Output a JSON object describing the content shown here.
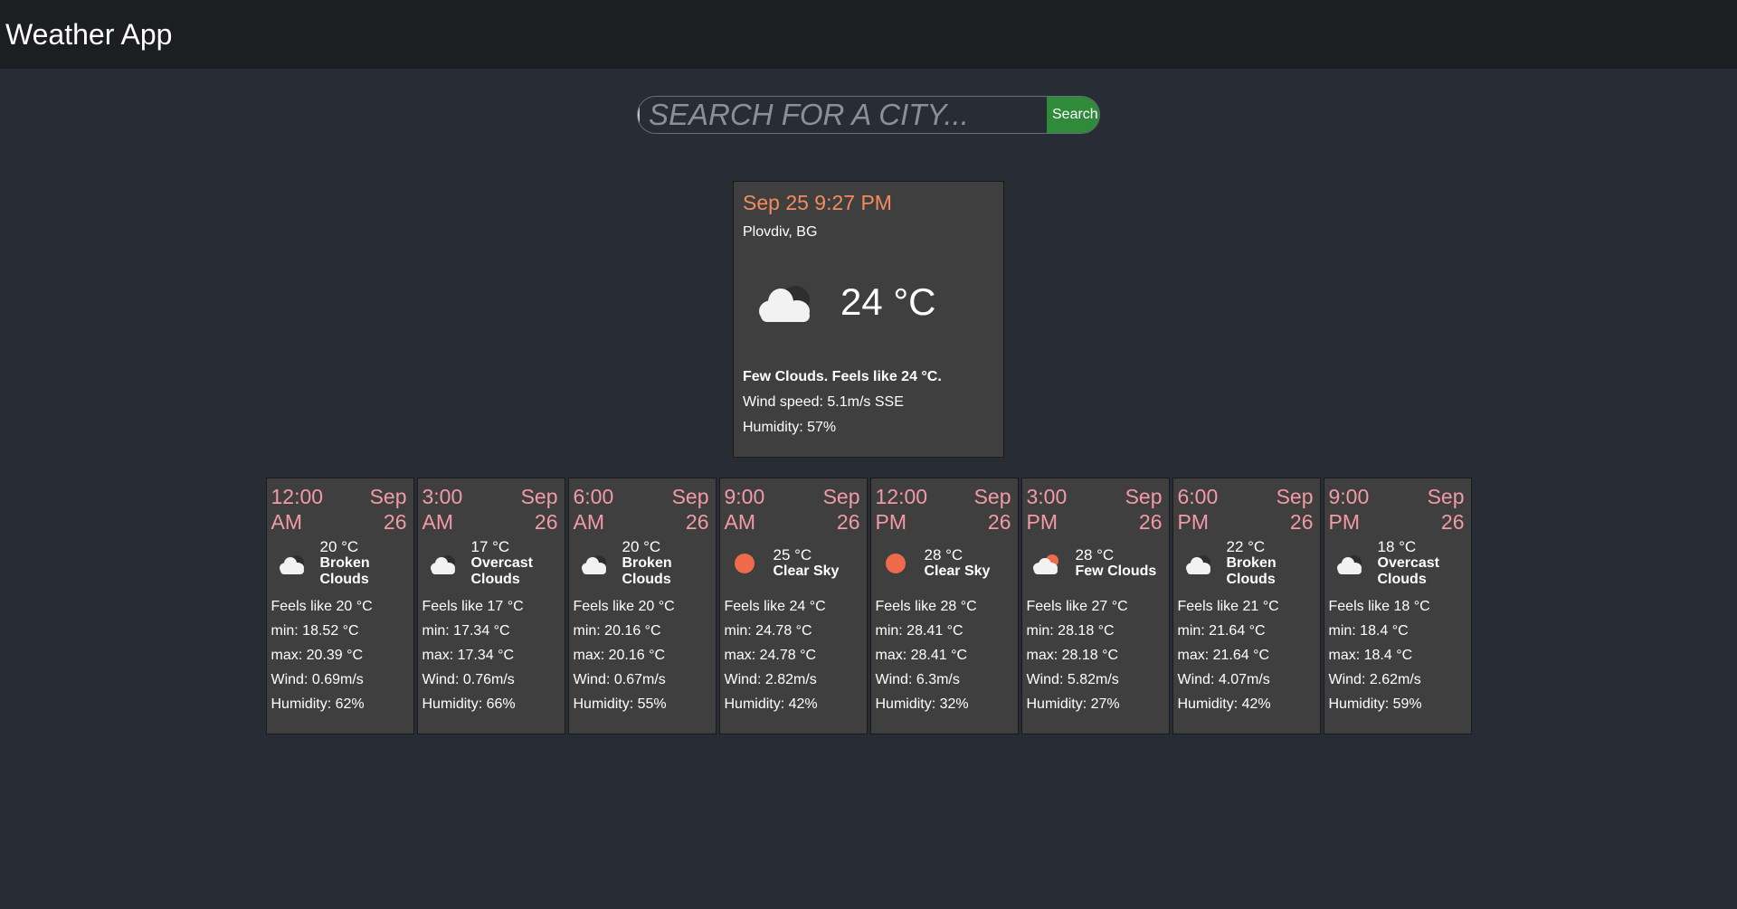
{
  "app": {
    "title": "Weather App"
  },
  "search": {
    "placeholder": "SEARCH FOR A CITY...",
    "value": "",
    "button_label": "Search"
  },
  "colors": {
    "navbar_bg": "#1c1e21",
    "page_bg": "#282c34",
    "card_bg": "#3f3f3f",
    "current_date_color": "#f28c5f",
    "forecast_header_color": "#f29aa6",
    "search_button_bg": "#2f8a3a",
    "sun_color": "#ee6a4a"
  },
  "current": {
    "datetime": "Sep 25 9:27 PM",
    "location": "Plovdiv, BG",
    "icon": "cloud-icon",
    "temperature": "24 °C",
    "summary": "Few Clouds. Feels like 24 °C.",
    "wind": "Wind speed: 5.1m/s SSE",
    "humidity": "Humidity: 57%"
  },
  "forecast": [
    {
      "time": "12:00 AM",
      "date": "Sep 26",
      "icon": "cloud-icon",
      "temp": "20 °C",
      "desc": "Broken Clouds",
      "feels": "Feels like 20 °C",
      "min": "min: 18.52 °C",
      "max": "max: 20.39 °C",
      "wind": "Wind: 0.69m/s",
      "humidity": "Humidity: 62%"
    },
    {
      "time": "3:00 AM",
      "date": "Sep 26",
      "icon": "cloud-icon",
      "temp": "17 °C",
      "desc": "Overcast Clouds",
      "feels": "Feels like 17 °C",
      "min": "min: 17.34 °C",
      "max": "max: 17.34 °C",
      "wind": "Wind: 0.76m/s",
      "humidity": "Humidity: 66%"
    },
    {
      "time": "6:00 AM",
      "date": "Sep 26",
      "icon": "cloud-icon",
      "temp": "20 °C",
      "desc": "Broken Clouds",
      "feels": "Feels like 20 °C",
      "min": "min: 20.16 °C",
      "max": "max: 20.16 °C",
      "wind": "Wind: 0.67m/s",
      "humidity": "Humidity: 55%"
    },
    {
      "time": "9:00 AM",
      "date": "Sep 26",
      "icon": "sun-icon",
      "temp": "25 °C",
      "desc": "Clear Sky",
      "feels": "Feels like 24 °C",
      "min": "min: 24.78 °C",
      "max": "max: 24.78 °C",
      "wind": "Wind: 2.82m/s",
      "humidity": "Humidity: 42%"
    },
    {
      "time": "12:00 PM",
      "date": "Sep 26",
      "icon": "sun-icon",
      "temp": "28 °C",
      "desc": "Clear Sky",
      "feels": "Feels like 28 °C",
      "min": "min: 28.41 °C",
      "max": "max: 28.41 °C",
      "wind": "Wind: 6.3m/s",
      "humidity": "Humidity: 32%"
    },
    {
      "time": "3:00 PM",
      "date": "Sep 26",
      "icon": "sun-cloud-icon",
      "temp": "28 °C",
      "desc": "Few Clouds",
      "feels": "Feels like 27 °C",
      "min": "min: 28.18 °C",
      "max": "max: 28.18 °C",
      "wind": "Wind: 5.82m/s",
      "humidity": "Humidity: 27%"
    },
    {
      "time": "6:00 PM",
      "date": "Sep 26",
      "icon": "cloud-icon",
      "temp": "22 °C",
      "desc": "Broken Clouds",
      "feels": "Feels like 21 °C",
      "min": "min: 21.64 °C",
      "max": "max: 21.64 °C",
      "wind": "Wind: 4.07m/s",
      "humidity": "Humidity: 42%"
    },
    {
      "time": "9:00 PM",
      "date": "Sep 26",
      "icon": "cloud-icon",
      "temp": "18 °C",
      "desc": "Overcast Clouds",
      "feels": "Feels like 18 °C",
      "min": "min: 18.4 °C",
      "max": "max: 18.4 °C",
      "wind": "Wind: 2.62m/s",
      "humidity": "Humidity: 59%"
    }
  ]
}
